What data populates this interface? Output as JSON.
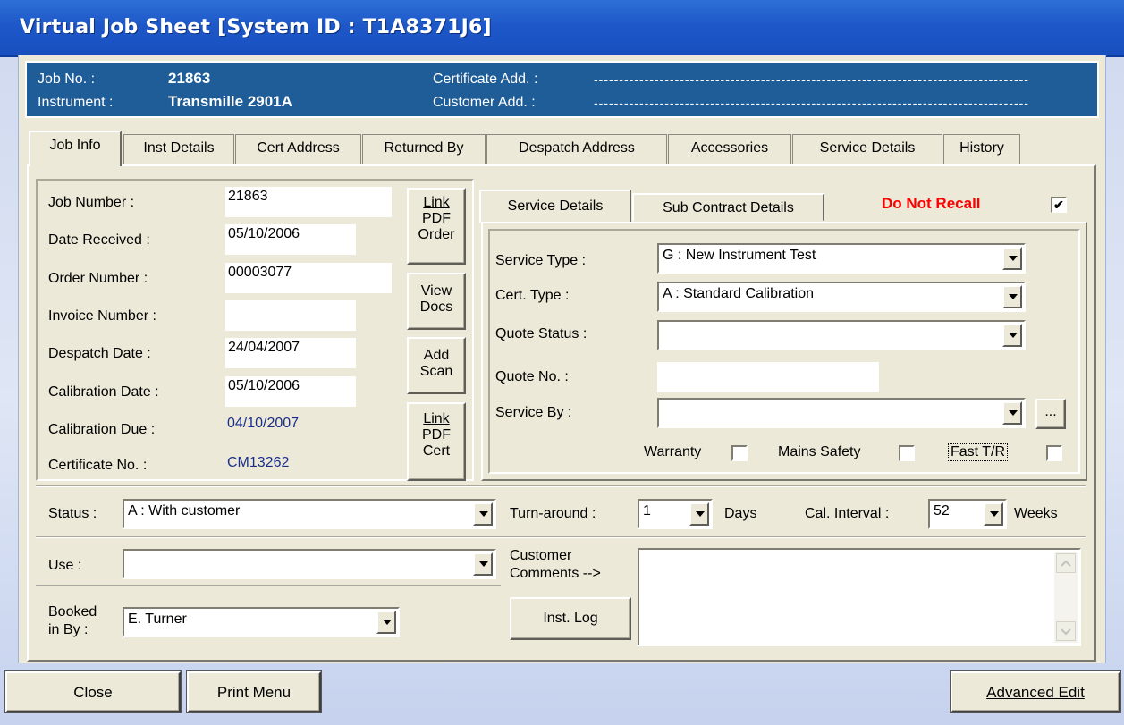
{
  "window": {
    "title": "Virtual Job Sheet [System ID : T1A8371J6]"
  },
  "infobar": {
    "job_no_label": "Job No. :",
    "job_no_value": "21863",
    "instrument_label": "Instrument :",
    "instrument_value": "Transmille 2901A",
    "certificate_add_label": "Certificate Add. :",
    "certificate_add_value": "--------------------------------------------------------------------------------------",
    "customer_add_label": "Customer  Add. :",
    "customer_add_value": "--------------------------------------------------------------------------------------"
  },
  "tabs": [
    {
      "label": "Job Info"
    },
    {
      "label": "Inst Details"
    },
    {
      "label": "Cert Address"
    },
    {
      "label": "Returned By"
    },
    {
      "label": "Despatch Address"
    },
    {
      "label": "Accessories"
    },
    {
      "label": "Service Details"
    },
    {
      "label": "History"
    }
  ],
  "job_info": {
    "job_number_label": "Job Number :",
    "job_number": "21863",
    "date_received_label": "Date Received :",
    "date_received": "05/10/2006",
    "order_number_label": "Order Number :",
    "order_number": "00003077",
    "invoice_number_label": "Invoice Number :",
    "invoice_number": "",
    "despatch_date_label": "Despatch Date :",
    "despatch_date": "24/04/2007",
    "calibration_date_label": "Calibration Date :",
    "calibration_date": "05/10/2006",
    "calibration_due_label": "Calibration Due :",
    "calibration_due": "04/10/2007",
    "certificate_no_label": "Certificate No. :",
    "certificate_no": "CM13262"
  },
  "side_buttons": {
    "link_pdf_order": [
      "Link",
      "PDF",
      "Order"
    ],
    "view_docs": [
      "View",
      "Docs"
    ],
    "add_scan": [
      "Add",
      "Scan"
    ],
    "link_pdf_cert": [
      "Link",
      "PDF",
      "Cert"
    ]
  },
  "service": {
    "tab_service_details": "Service Details",
    "tab_sub_contract": "Sub Contract Details",
    "do_not_recall": "Do Not Recall",
    "do_not_recall_checked": "✔",
    "service_type_label": "Service Type :",
    "service_type": "G : New Instrument Test",
    "cert_type_label": "Cert. Type :",
    "cert_type": "A : Standard Calibration",
    "quote_status_label": "Quote Status :",
    "quote_status": "",
    "quote_no_label": "Quote No. :",
    "quote_no": "",
    "service_by_label": "Service By :",
    "service_by": "",
    "ellipsis": "...",
    "warranty_label": "Warranty",
    "mains_safety_label": "Mains Safety",
    "fast_tr_label": "Fast T/R"
  },
  "status_row": {
    "status_label": "Status :",
    "status": "A : With customer",
    "turnaround_label": "Turn-around :",
    "turnaround": "1",
    "days_label": "Days",
    "cal_interval_label": "Cal. Interval :",
    "cal_interval": "52",
    "weeks_label": "Weeks"
  },
  "use_row": {
    "use_label": "Use :",
    "use": "",
    "customer_comments_label_1": "Customer",
    "customer_comments_label_2": "Comments -->",
    "customer_comments": "",
    "inst_log": "Inst. Log",
    "booked_in_label_1": "Booked",
    "booked_in_label_2": "in By :",
    "booked_in_by": "E. Turner"
  },
  "bottom_buttons": {
    "close": "Close",
    "print_menu": "Print Menu",
    "advanced_edit": "Advanced Edit"
  }
}
